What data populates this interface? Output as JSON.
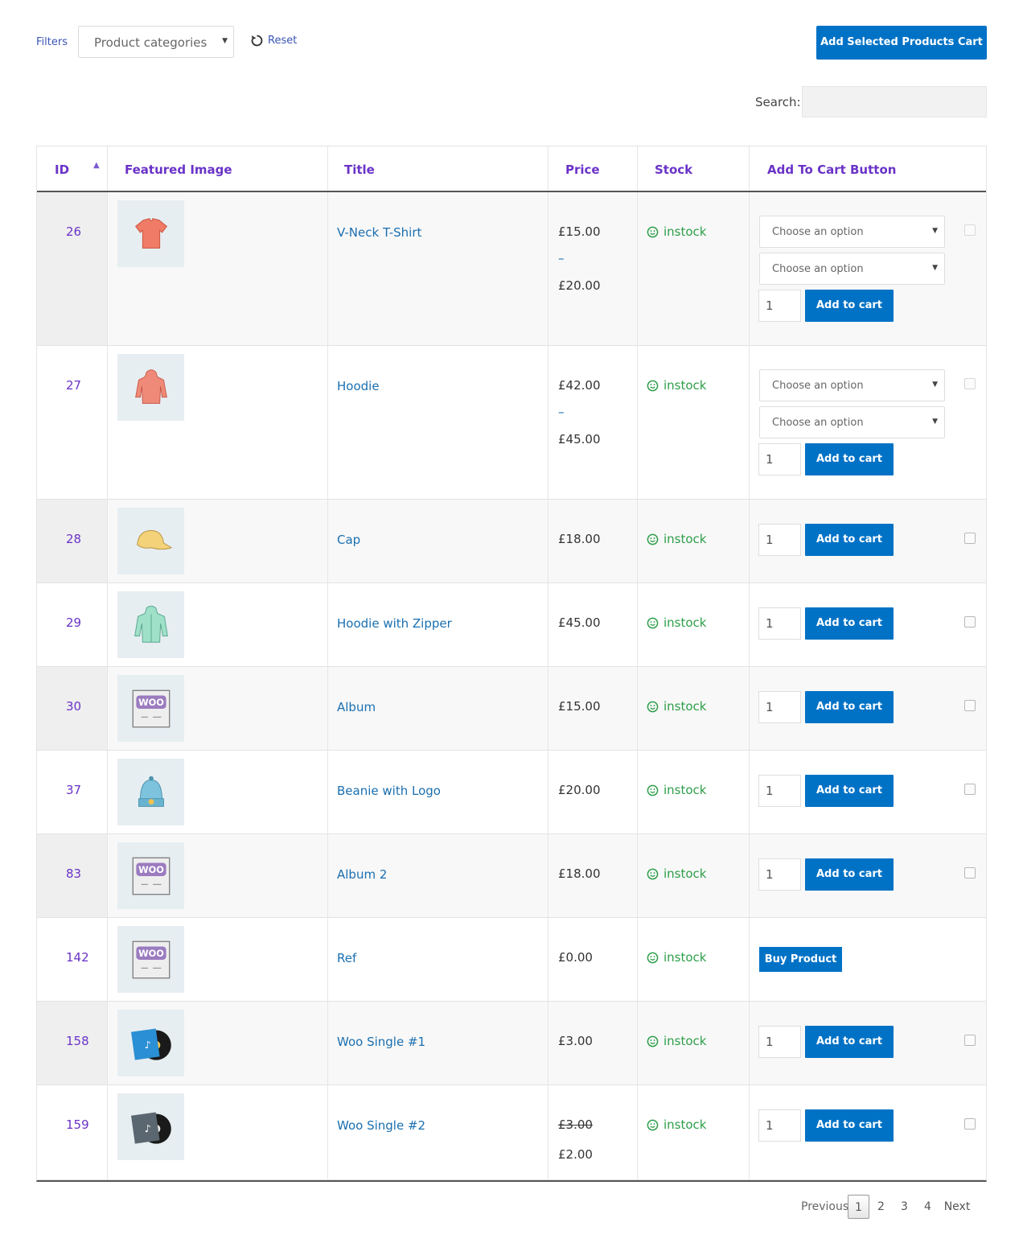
{
  "filters": {
    "label": "Filters",
    "category_select": "Product categories",
    "reset_label": "Reset"
  },
  "add_selected_label": "Add Selected Products Cart",
  "search": {
    "label": "Search:",
    "value": ""
  },
  "table": {
    "headers": {
      "id": "ID",
      "image": "Featured Image",
      "title": "Title",
      "price": "Price",
      "stock": "Stock",
      "cart": "Add To Cart Button"
    },
    "sort_indicator": "▲",
    "rows": [
      {
        "id": "26",
        "title": "V-Neck T-Shirt",
        "price_from": "£15.00",
        "dash": "–",
        "price_to": "£20.00",
        "stock": "instock",
        "option1": "Choose an option",
        "option2": "Choose an option",
        "qty": "1",
        "button": "Add to cart",
        "image": "tshirt-image"
      },
      {
        "id": "27",
        "title": "Hoodie",
        "price_from": "£42.00",
        "dash": "–",
        "price_to": "£45.00",
        "stock": "instock",
        "option1": "Choose an option",
        "option2": "Choose an option",
        "qty": "1",
        "button": "Add to cart",
        "image": "hoodie-image"
      },
      {
        "id": "28",
        "title": "Cap",
        "price": "£18.00",
        "stock": "instock",
        "qty": "1",
        "button": "Add to cart",
        "image": "cap-image"
      },
      {
        "id": "29",
        "title": "Hoodie with Zipper",
        "price": "£45.00",
        "stock": "instock",
        "qty": "1",
        "button": "Add to cart",
        "image": "zip-hoodie-image"
      },
      {
        "id": "30",
        "title": "Album",
        "price": "£15.00",
        "stock": "instock",
        "qty": "1",
        "button": "Add to cart",
        "image": "woo-album-image"
      },
      {
        "id": "37",
        "title": "Beanie with Logo",
        "price": "£20.00",
        "stock": "instock",
        "qty": "1",
        "button": "Add to cart",
        "image": "beanie-image"
      },
      {
        "id": "83",
        "title": "Album 2",
        "price": "£18.00",
        "stock": "instock",
        "qty": "1",
        "button": "Add to cart",
        "image": "woo-album-image"
      },
      {
        "id": "142",
        "title": "Ref",
        "price": "£0.00",
        "stock": "instock",
        "button": "Buy Product",
        "image": "woo-album-image"
      },
      {
        "id": "158",
        "title": "Woo Single #1",
        "price": "£3.00",
        "stock": "instock",
        "qty": "1",
        "button": "Add to cart",
        "image": "vinyl-blue-image"
      },
      {
        "id": "159",
        "title": "Woo Single #2",
        "price_old": "£3.00",
        "price": "£2.00",
        "stock": "instock",
        "qty": "1",
        "button": "Add to cart",
        "image": "vinyl-gray-image"
      }
    ]
  },
  "woo_text": "WOO",
  "pagination": {
    "previous": "Previous",
    "pages": [
      "1",
      "2",
      "3",
      "4"
    ],
    "current": "1",
    "next": "Next"
  },
  "colors": {
    "accent": "#0072c6",
    "header_text": "#6a33c7",
    "link": "#1a6fb0",
    "stock": "#2d9e49"
  }
}
